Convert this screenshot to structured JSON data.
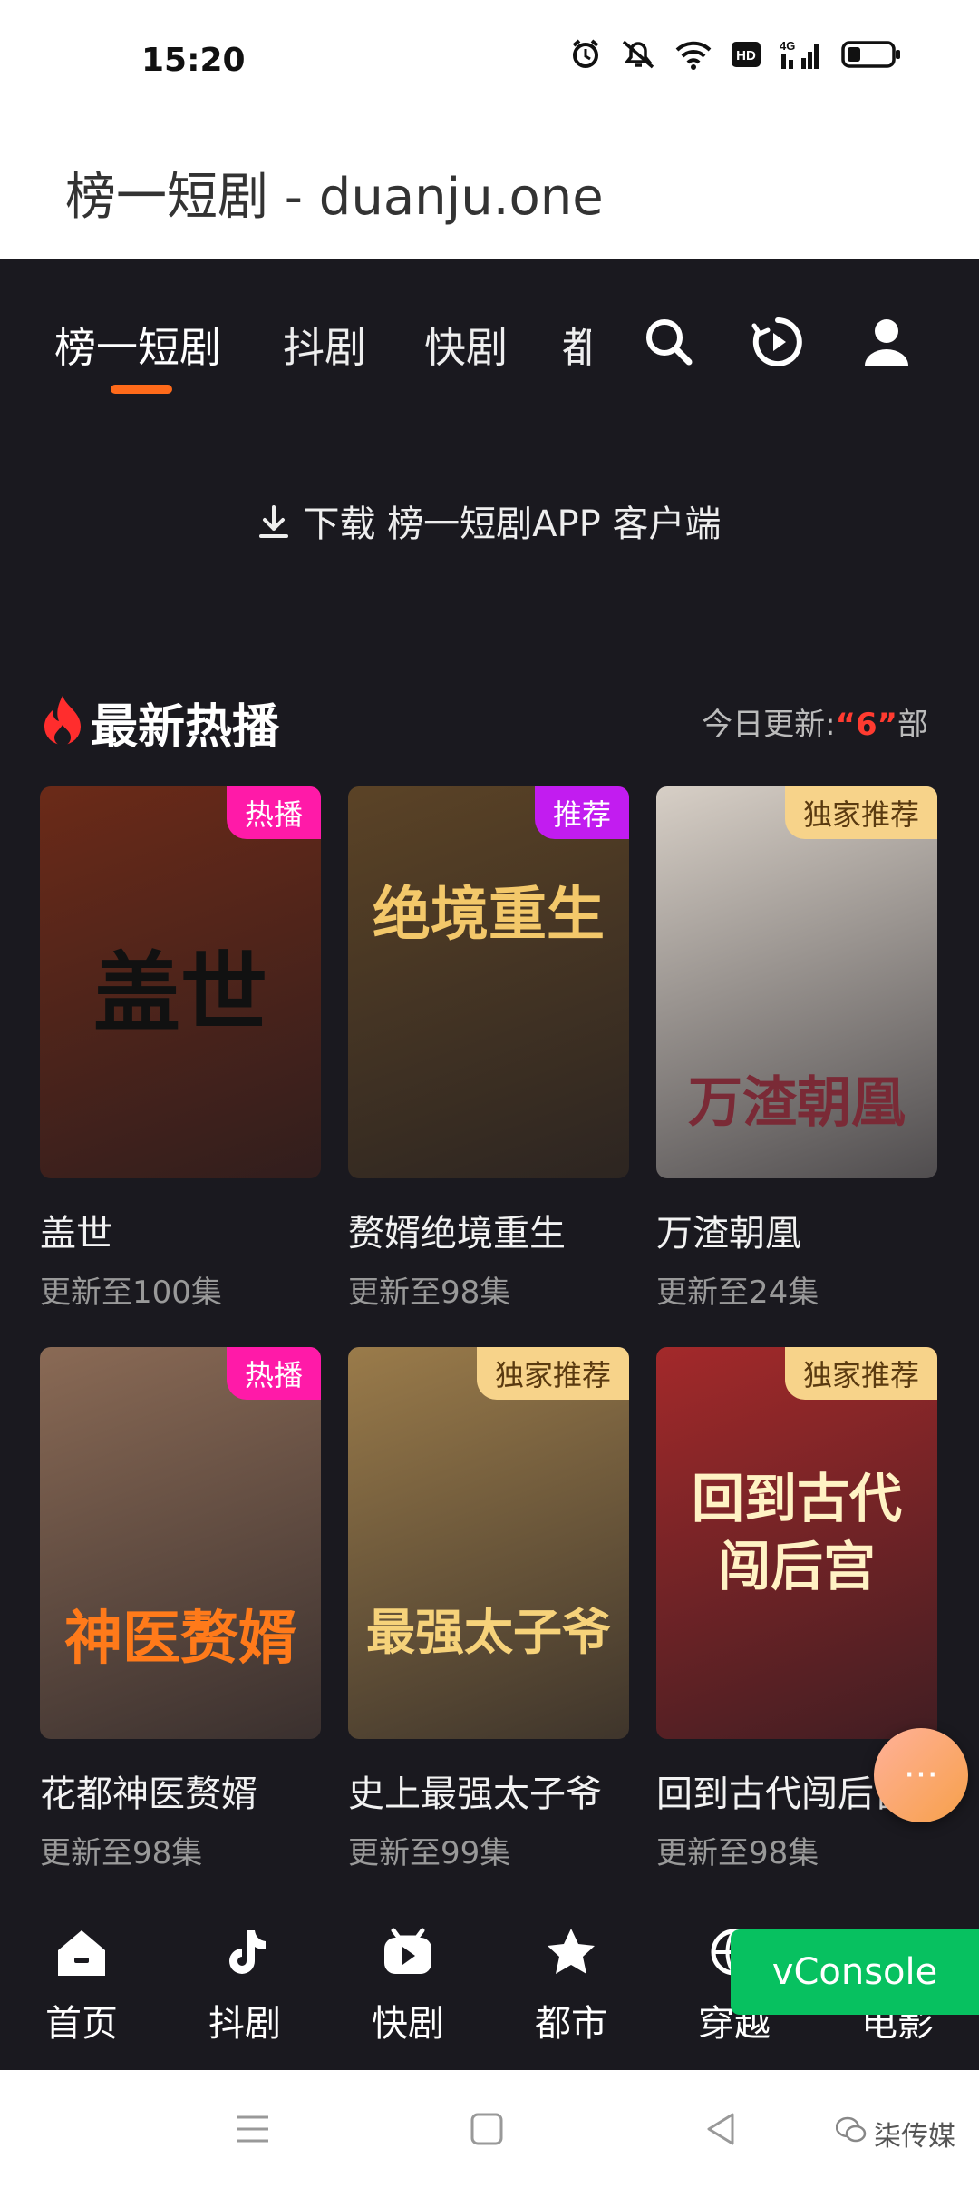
{
  "status_bar": {
    "time": "15:20",
    "network": "4G"
  },
  "browser": {
    "title": "榜一短剧 - duanju.one"
  },
  "top_nav": {
    "tabs": [
      "榜一短剧",
      "抖剧",
      "快剧",
      "都"
    ],
    "active_tab": "榜一短剧",
    "icons": [
      "search-icon",
      "play-history-icon",
      "user-icon"
    ]
  },
  "download_bar": {
    "text": "下载 榜一短剧APP 客户端"
  },
  "section": {
    "title": "最新热播",
    "today_label": "今日更新:",
    "today_count": "“6”",
    "today_unit": "部"
  },
  "dramas": [
    {
      "title": "盖世",
      "episodes": "更新至100集",
      "badge": "热播",
      "badge_type": "hot",
      "poster_text": "盖世",
      "poster_color": "#6b2a18"
    },
    {
      "title": "赘婿绝境重生",
      "episodes": "更新至98集",
      "badge": "推荐",
      "badge_type": "rec",
      "poster_text": "绝境重生",
      "poster_color": "#5b4326"
    },
    {
      "title": "万渣朝凰",
      "episodes": "更新至24集",
      "badge": "独家推荐",
      "badge_type": "excl",
      "poster_text": "万渣朝凰",
      "poster_color": "#d7cfc6"
    },
    {
      "title": "花都神医赘婿",
      "episodes": "更新至98集",
      "badge": "热播",
      "badge_type": "hot",
      "poster_text": "神医赘婿",
      "poster_color": "#8a6a55"
    },
    {
      "title": "史上最强太子爷",
      "episodes": "更新至99集",
      "badge": "独家推荐",
      "badge_type": "excl",
      "poster_text": "最强太子爷",
      "poster_color": "#9a7b4a"
    },
    {
      "title": "回到古代闯后宫",
      "episodes": "更新至98集",
      "badge": "独家推荐",
      "badge_type": "excl",
      "poster_text": "回到古代 闯后宫",
      "poster_color": "#a3292a"
    }
  ],
  "bottom_nav": [
    {
      "label": "首页",
      "icon": "home-icon"
    },
    {
      "label": "抖剧",
      "icon": "tiktok-icon"
    },
    {
      "label": "快剧",
      "icon": "kuaishou-icon"
    },
    {
      "label": "都市",
      "icon": "star-icon"
    },
    {
      "label": "穿越",
      "icon": "globe-icon"
    },
    {
      "label": "电影",
      "icon": "film-icon"
    }
  ],
  "fab": {
    "label": "···"
  },
  "vconsole": {
    "label": "vConsole"
  },
  "watermark": {
    "text": "柒传媒"
  }
}
